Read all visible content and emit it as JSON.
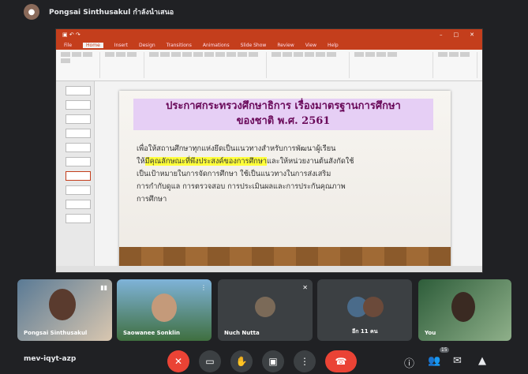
{
  "meeting": {
    "presenter_label": "Pongsai Sinthusakul กำลังนำเสนอ",
    "meeting_code": "mev-iqyt-azp",
    "participant_count": "15"
  },
  "powerpoint": {
    "tabs": [
      "File",
      "Home",
      "Insert",
      "Design",
      "Transitions",
      "Animations",
      "Slide Show",
      "Review",
      "View",
      "Help"
    ],
    "active_tab": "Home"
  },
  "slide": {
    "heading_line1": "ประกาศกระทรวงศึกษาธิการ เรื่องมาตรฐานการศึกษา",
    "heading_line2": "ของชาติ พ.ศ. 2561",
    "body_line1": "เพื่อให้สถานศึกษาทุกแห่งยึดเป็นแนวทางสำหรับการพัฒนาผู้เรียน",
    "body_line2_pre": "ให้",
    "body_line2_highlight": "มีคุณลักษณะที่พึงประสงค์ของการศึกษา",
    "body_line2_post": "และให้หน่วยงานต้นสังกัดใช้",
    "body_line3": "เป็นเป้าหมายในการจัดการศึกษา ใช้เป็นแนวทางในการส่งเสริม",
    "body_line4": "การกำกับดูแล การตรวจสอบ การประเมินผลและการประกันคุณภาพ",
    "body_line5": "การศึกษา"
  },
  "participants": [
    {
      "name": "Pongsai Sinthusakul"
    },
    {
      "name": "Saowanee Sonklin"
    },
    {
      "name": "Nuch Nutta"
    },
    {
      "name": "อีก 11 คน"
    },
    {
      "name": "You"
    }
  ],
  "colors": {
    "background": "#202124",
    "ppt_accent": "#c43e1c",
    "end_call": "#ea4335",
    "slide_heading_bg": "#e6cff5"
  }
}
